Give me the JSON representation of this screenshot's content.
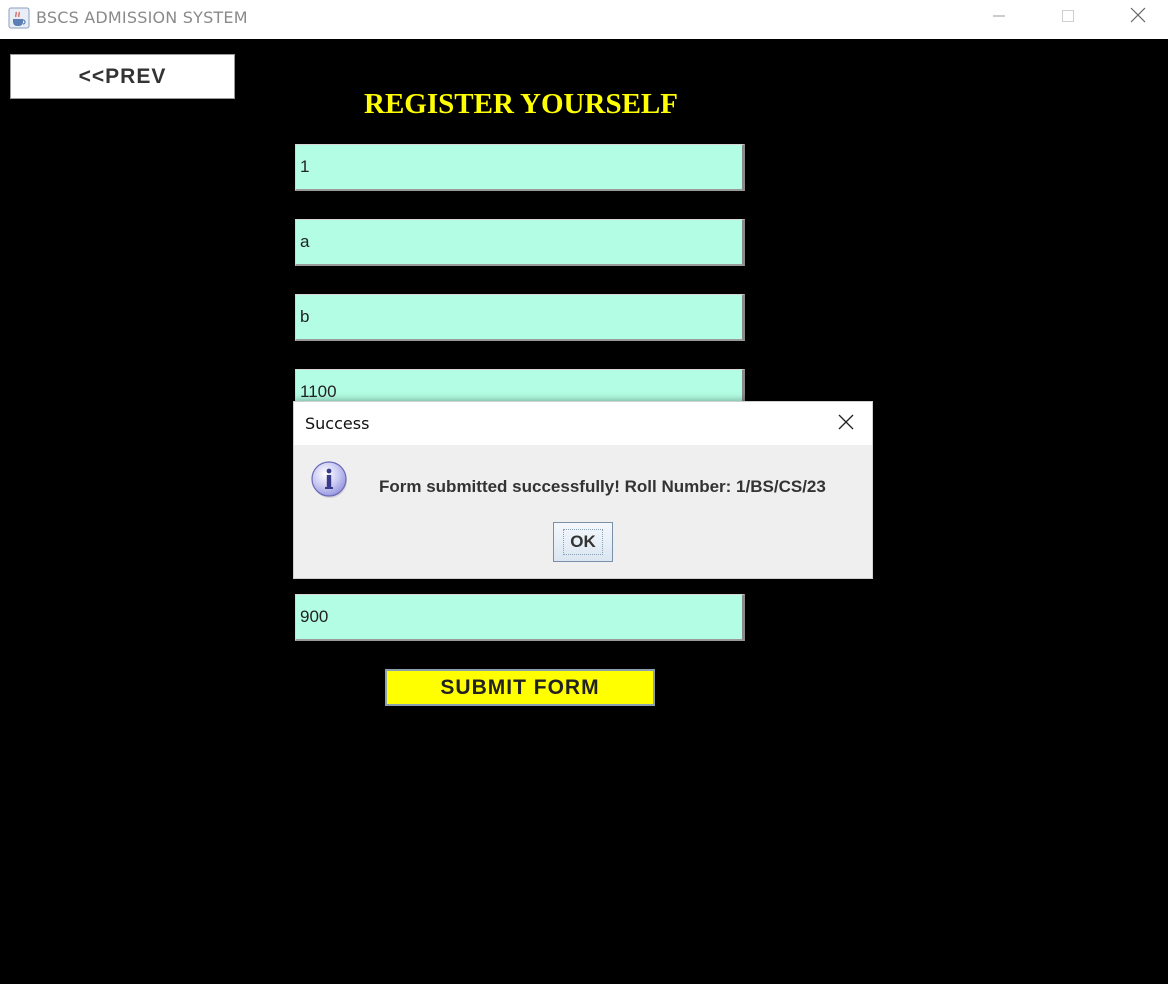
{
  "window": {
    "title": "BSCS ADMISSION SYSTEM",
    "app_icon": "java-cup-icon",
    "controls": [
      "minimize-icon",
      "maximize-icon",
      "close-icon"
    ]
  },
  "form": {
    "prev_label": "<<PREV",
    "heading": "REGISTER YOURSELF",
    "fields": {
      "field1": "1",
      "field2": "a",
      "field3": "b",
      "field4": "1100",
      "field5": "900"
    },
    "submit_label": "SUBMIT FORM"
  },
  "dialog": {
    "title": "Success",
    "message": "Form submitted successfully! Roll Number: 1/BS/CS/23",
    "ok_label": "OK",
    "icon": "info-icon"
  },
  "colors": {
    "background": "#000000",
    "heading": "#ffff00",
    "field_bg": "#b2fde3",
    "submit_bg": "#ffff00"
  }
}
